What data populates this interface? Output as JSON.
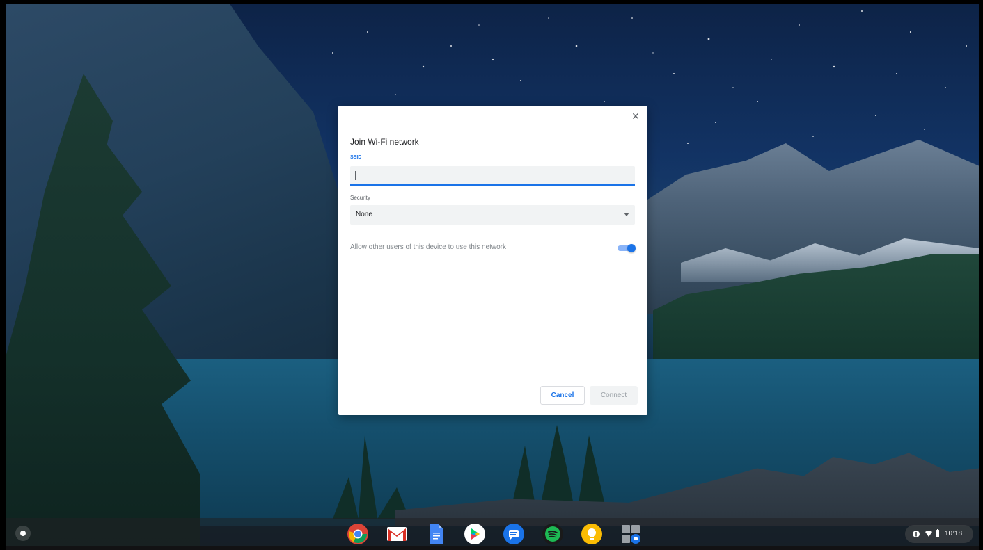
{
  "dialog": {
    "title": "Join Wi-Fi network",
    "close_glyph": "✕",
    "ssid_label": "SSID",
    "ssid_value": "",
    "security_label": "Security",
    "security_value": "None",
    "share_label": "Allow other users of this device to use this network",
    "share_enabled": true,
    "cancel_label": "Cancel",
    "connect_label": "Connect"
  },
  "shelf": {
    "apps": [
      {
        "name": "chrome-icon"
      },
      {
        "name": "gmail-icon"
      },
      {
        "name": "docs-icon"
      },
      {
        "name": "play-store-icon"
      },
      {
        "name": "messages-icon"
      },
      {
        "name": "spotify-icon"
      },
      {
        "name": "keep-icon"
      },
      {
        "name": "files-icon"
      }
    ],
    "status": {
      "time": "10:18",
      "icons": [
        "notification-icon",
        "wifi-icon",
        "battery-icon"
      ]
    }
  },
  "colors": {
    "accent": "#1a73e8",
    "toggle_track": "#8ab4f8"
  }
}
